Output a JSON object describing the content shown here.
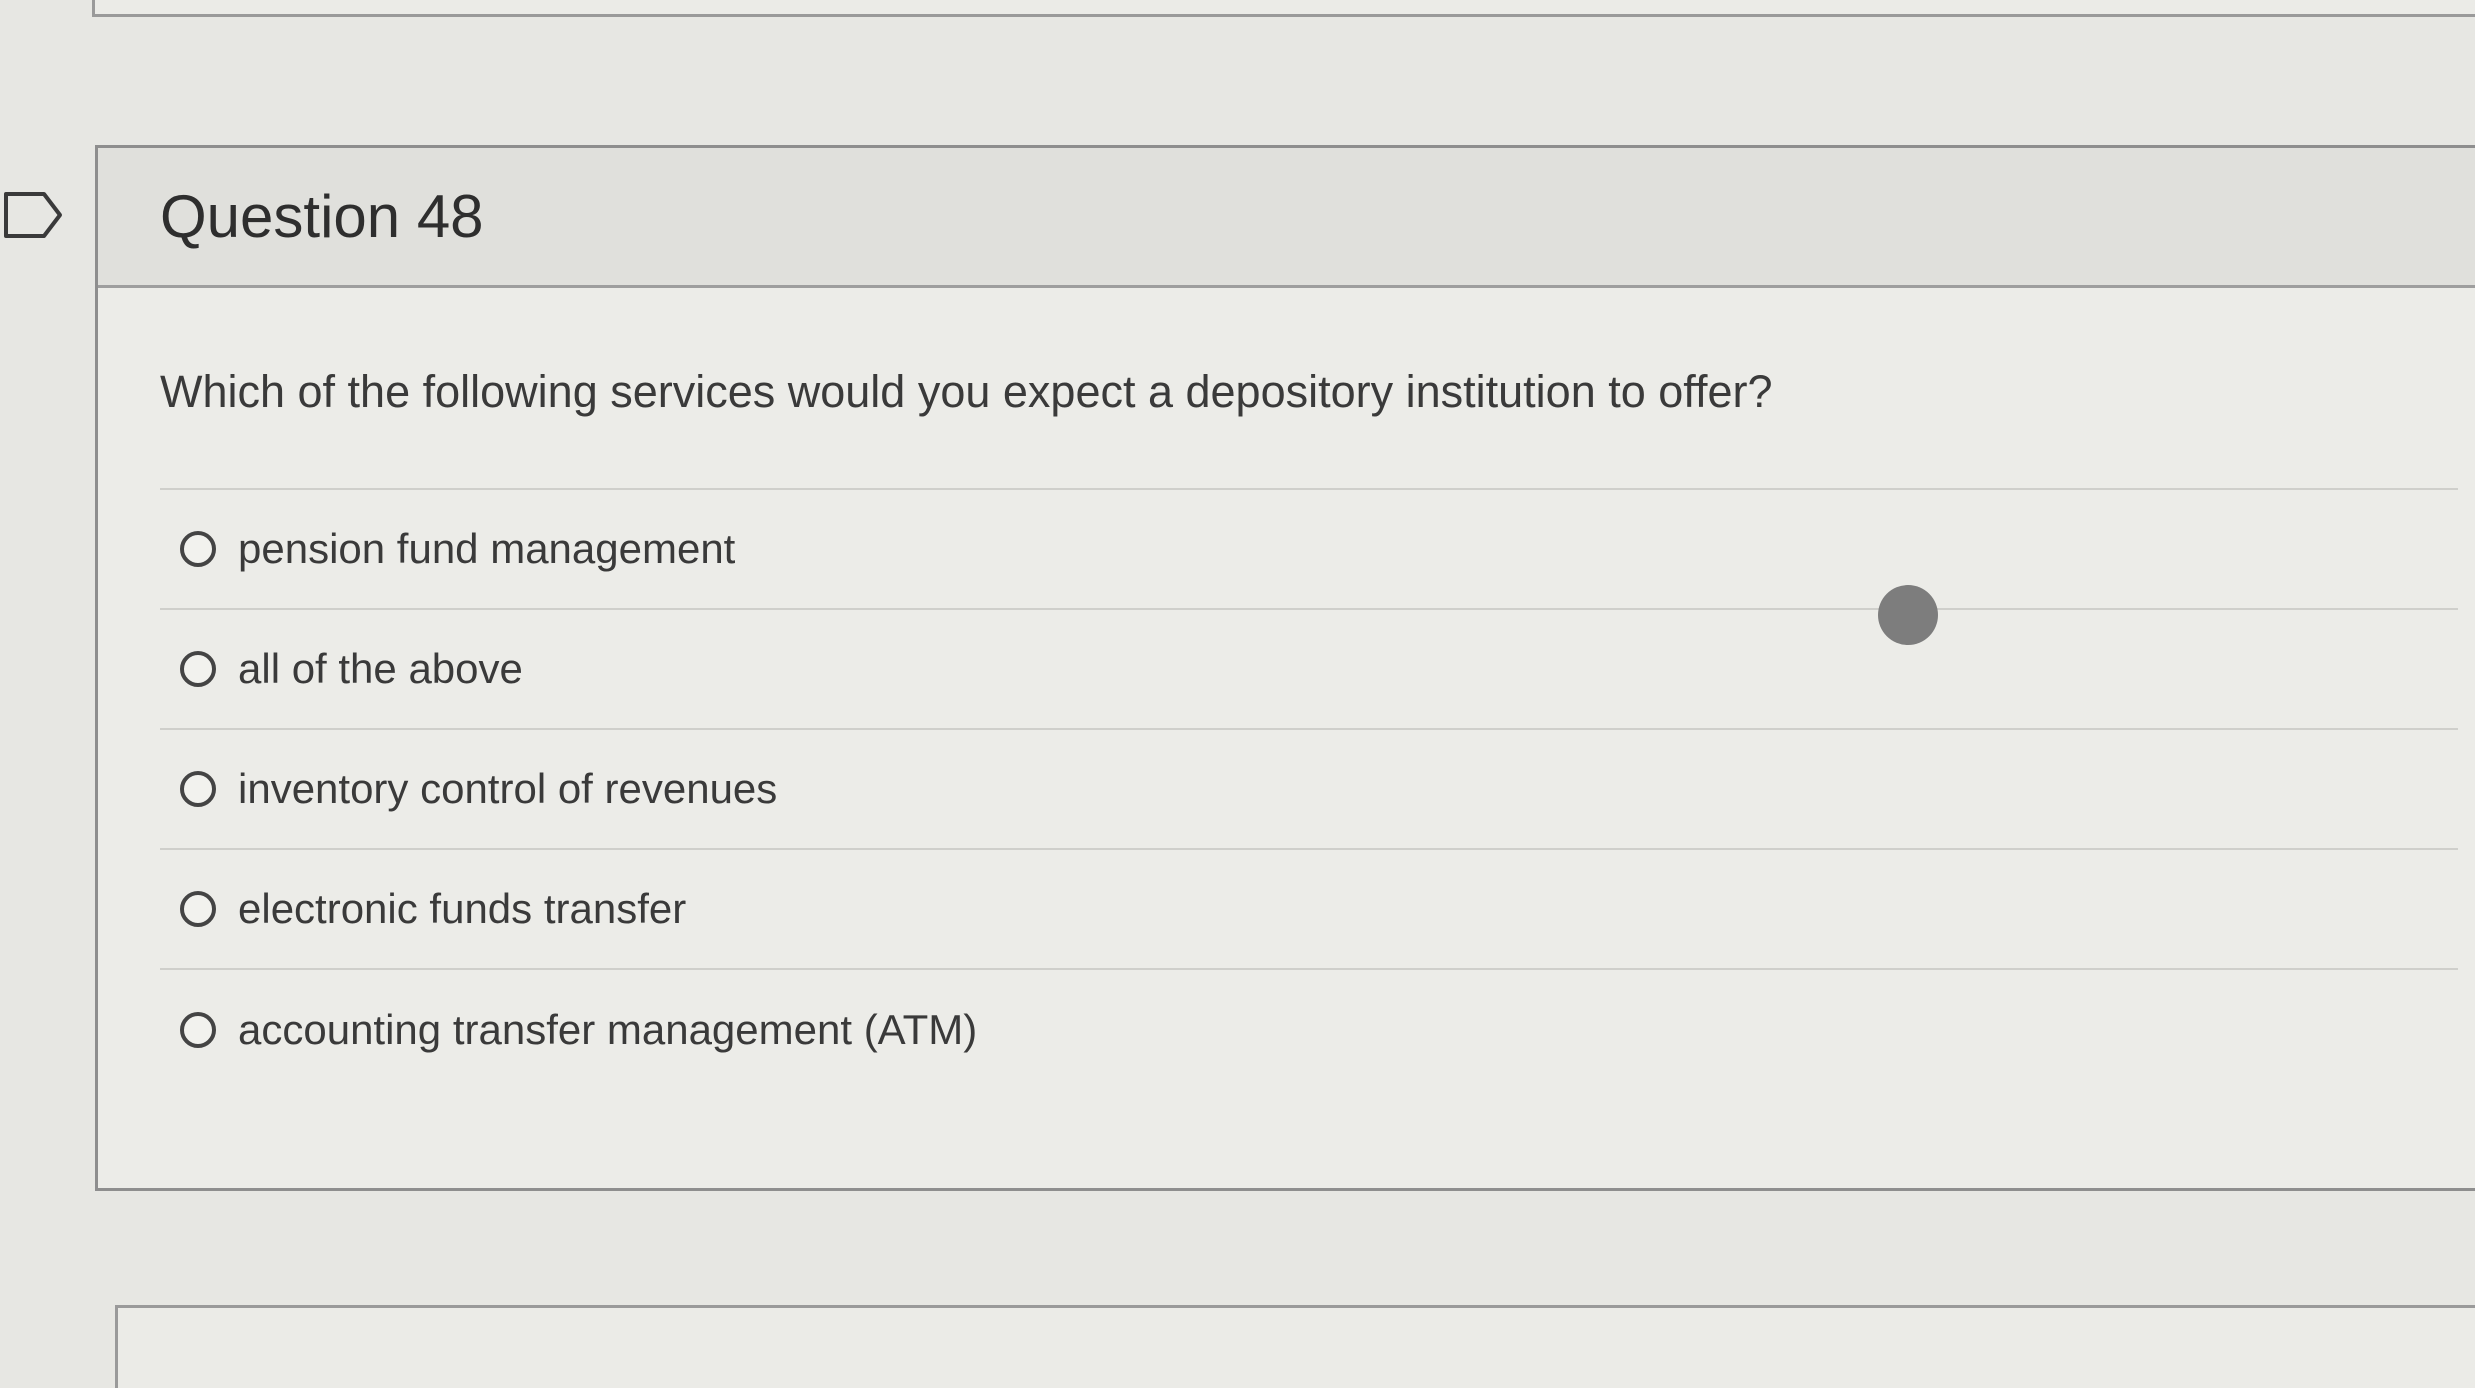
{
  "question": {
    "title": "Question 48",
    "text": "Which of the following services would you expect a depository institution to offer?",
    "answers": [
      {
        "label": "pension fund management"
      },
      {
        "label": "all of the above"
      },
      {
        "label": "inventory control of revenues"
      },
      {
        "label": "electronic funds transfer"
      },
      {
        "label": "accounting transfer management (ATM)"
      }
    ]
  },
  "icons": {
    "flag": "flag-tab-icon",
    "radio": "radio-unselected-icon"
  },
  "colors": {
    "background": "#e7e7e3",
    "border": "#8e8e8e",
    "text": "#3a3a3a"
  }
}
